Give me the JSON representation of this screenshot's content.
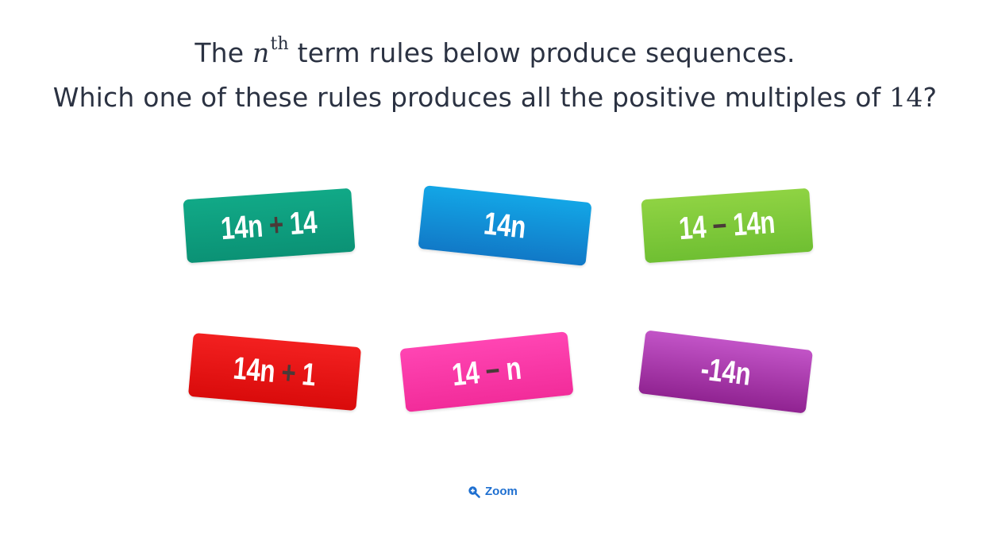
{
  "question": {
    "line1_before": "The",
    "line1_var": "n",
    "line1_sup": "th",
    "line1_after": "term rules below produce sequences.",
    "line2_before": "Which one of these rules produces all the positive multiples of",
    "line2_number": "14",
    "line2_after": "?"
  },
  "options": [
    {
      "a": "14n",
      "op": "+",
      "b": "14",
      "color": "#0b9f80"
    },
    {
      "a": "14n",
      "op": "",
      "b": "",
      "color": "#1291d8"
    },
    {
      "a": "14",
      "op": "−",
      "b": "14n",
      "color": "#7fca3a"
    },
    {
      "a": "14n",
      "op": "+",
      "b": "1",
      "color": "#e61414"
    },
    {
      "a": "14",
      "op": "−",
      "b": "n",
      "color": "#f83aa7"
    },
    {
      "a": "-14n",
      "op": "",
      "b": "",
      "color": "#a93aac"
    }
  ],
  "zoom": {
    "label": "Zoom",
    "icon": "zoom-in-icon"
  }
}
